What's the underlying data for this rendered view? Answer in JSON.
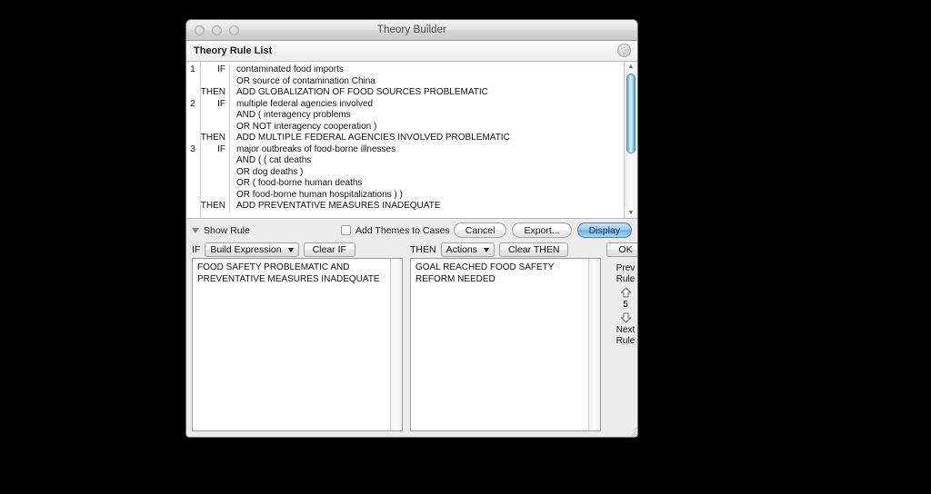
{
  "window": {
    "title": "Theory Builder",
    "traffic_lights": [
      "close-button",
      "minimize-button",
      "zoom-button"
    ]
  },
  "section": {
    "title": "Theory Rule List",
    "help_label": "?"
  },
  "rule_list": {
    "rows": [
      {
        "num": "1",
        "kw": "IF",
        "text": "contaminated food imports"
      },
      {
        "num": "",
        "kw": "",
        "text": "OR source of contamination China"
      },
      {
        "num": "",
        "kw": "THEN",
        "text": "ADD GLOBALIZATION OF FOOD SOURCES PROBLEMATIC"
      },
      {
        "num": "2",
        "kw": "IF",
        "text": "multiple federal agencies involved"
      },
      {
        "num": "",
        "kw": "",
        "text": "AND ( interagency problems"
      },
      {
        "num": "",
        "kw": "",
        "text": "OR NOT interagency cooperation )"
      },
      {
        "num": "",
        "kw": "THEN",
        "text": "ADD MULTIPLE FEDERAL AGENCIES INVOLVED PROBLEMATIC"
      },
      {
        "num": "3",
        "kw": "IF",
        "text": "major outbreaks of food-borne illnesses"
      },
      {
        "num": "",
        "kw": "",
        "text": "AND ( ( cat deaths"
      },
      {
        "num": "",
        "kw": "",
        "text": "OR dog deaths )"
      },
      {
        "num": "",
        "kw": "",
        "text": "OR ( food-borne human deaths"
      },
      {
        "num": "",
        "kw": "",
        "text": "OR food-borne human hospitalizations ) )"
      },
      {
        "num": "",
        "kw": "THEN",
        "text": "ADD PREVENTATIVE MEASURES INADEQUATE"
      }
    ],
    "scrollbar": {
      "up_arrow": "▲",
      "down_arrow": "▼"
    }
  },
  "toolbar": {
    "show_rule_label": "Show Rule",
    "checkbox_label": "Add Themes to Cases",
    "checkbox_checked": false,
    "cancel_label": "Cancel",
    "export_label": "Export...",
    "display_label": "Display"
  },
  "if_pane": {
    "keyword": "IF",
    "popup_label": "Build Expression",
    "clear_label": "Clear IF",
    "text": "FOOD SAFETY PROBLEMATIC AND\nPREVENTATIVE MEASURES INADEQUATE"
  },
  "then_pane": {
    "keyword": "THEN",
    "popup_label": "Actions",
    "clear_label": "Clear THEN",
    "text": "GOAL REACHED FOOD SAFETY\nREFORM NEEDED"
  },
  "nav": {
    "ok_label": "OK",
    "prev_label": "Prev\nRule",
    "next_label": "Next\nRule",
    "rule_number": "5"
  },
  "colors": {
    "window_chrome": "#ededed",
    "default_button_accent": "#6fb3e3",
    "scroll_thumb": "#5fa8e0",
    "desktop": "#000000"
  }
}
